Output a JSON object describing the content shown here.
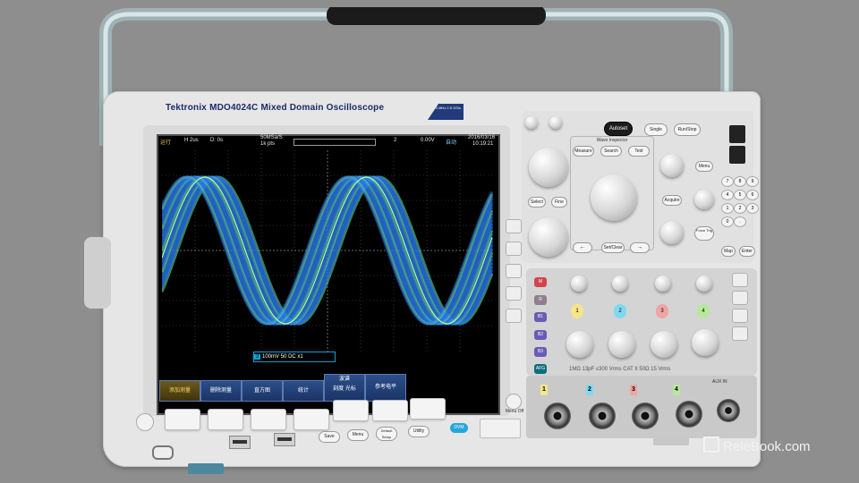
{
  "device": {
    "brand": "Tektronix",
    "model": "MDO4024C Mixed Domain Oscilloscope",
    "badge": "200 MHz 2.5 GS/s"
  },
  "screen": {
    "status": {
      "run": "运行",
      "horizontal": "H 2us",
      "delay": "D: 0s",
      "sample_rate": "50MSa/S",
      "points": "1k pts",
      "trigger_source": "2",
      "trigger_level": "0.00V",
      "auto": "自动",
      "date": "2016/03/16",
      "time": "10:19:21"
    },
    "channel_readout": {
      "channel": "2",
      "scale": "100mV",
      "impedance": "50",
      "coupling": "DC",
      "probe": "x1"
    },
    "softkeys": [
      "添加测量",
      "删除测量",
      "直方图",
      "统计",
      "波谱",
      "参考电平"
    ],
    "softkey_sub": [
      "",
      "",
      "",
      "",
      "刻度 光标",
      ""
    ]
  },
  "panel": {
    "autoset": "Autoset",
    "single": "Single",
    "run_stop": "Run/Stop",
    "wave_inspector": "Wave Inspector",
    "measure": "Measure",
    "search": "Search",
    "test": "Test",
    "select": "Select",
    "fine": "Fine",
    "menu": "Menu",
    "acquire": "Acquire",
    "force_trig": "Force Trig",
    "set_clear": "Set/Clear",
    "keypad": [
      "7",
      "8",
      "9",
      "4",
      "5",
      "6",
      "1",
      "2",
      "3",
      "0",
      "."
    ],
    "map": "Map",
    "enter": "Enter",
    "m_btn": "M",
    "r_btn": "R",
    "b1": "B1",
    "b2": "B2",
    "b3": "B3",
    "afg": "AFG",
    "channels": [
      "1",
      "2",
      "3",
      "4"
    ],
    "aux_in": "AUX IN",
    "input_spec": "1MΩ 13pF ≤300 Vrms CAT II 50Ω 15 Vrms"
  },
  "bottom": {
    "save": "Save",
    "menu": "Menu",
    "default_setup": "Default Setup",
    "utility": "Utility",
    "dvm": "DVM",
    "menu_off": "Menu Off"
  },
  "watermark": "RelеBook.com",
  "chart_data": {
    "type": "line",
    "series": [
      {
        "values": [
          0.0,
          0.8,
          0.95,
          0.3,
          -0.6,
          -0.95,
          -0.4,
          0.5,
          0.95,
          0.6,
          -0.3
        ]
      }
    ]
  }
}
